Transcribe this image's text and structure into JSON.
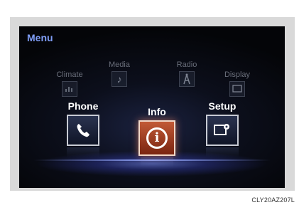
{
  "menu": {
    "title": "Menu"
  },
  "back_row": [
    {
      "label": "Climate",
      "icon": "climate-icon",
      "glyph": "❄"
    },
    {
      "label": "Media",
      "icon": "music-note-icon",
      "glyph": "♪"
    },
    {
      "label": "Radio",
      "icon": "radio-tower-icon",
      "glyph": "Ä"
    },
    {
      "label": "Display",
      "icon": "display-icon",
      "glyph": "▭"
    }
  ],
  "front_row": [
    {
      "label": "Phone",
      "icon": "phone-icon",
      "glyph": "✆"
    },
    {
      "label": "Info",
      "icon": "info-icon",
      "glyph": "i",
      "selected": true
    },
    {
      "label": "Setup",
      "icon": "setup-icon",
      "glyph": "⚙"
    }
  ],
  "caption": "CLY20AZ207L",
  "colors": {
    "accent": "#7f9df5",
    "selected_tile": "#a8401f",
    "glow": "#7080ff"
  }
}
